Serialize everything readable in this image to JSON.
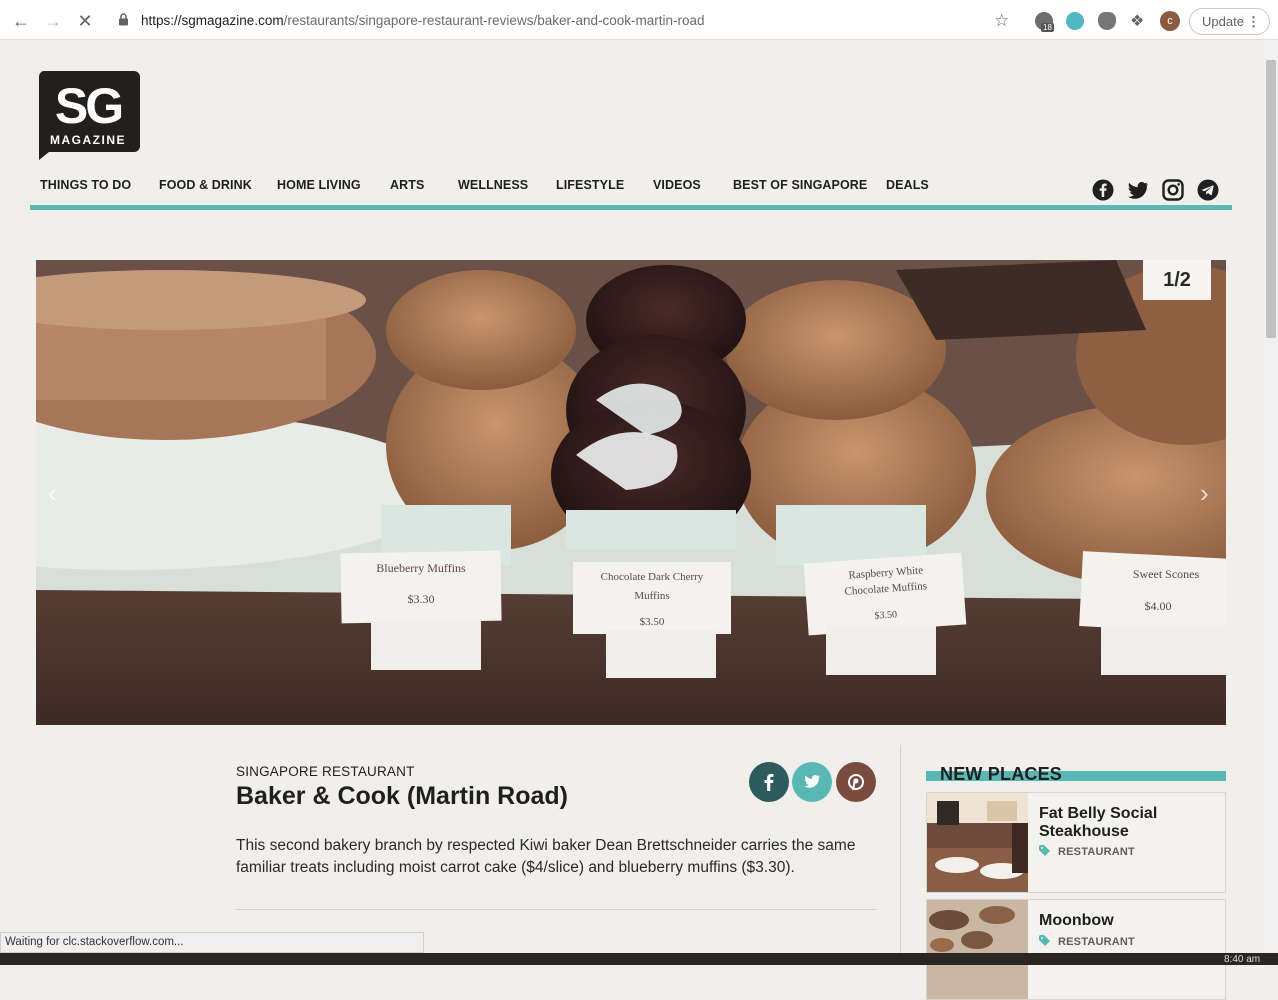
{
  "browser": {
    "url_host": "https://sgmagazine.com",
    "url_path": "/restaurants/singapore-restaurant-reviews/baker-and-cook-martin-road",
    "update_label": "Update",
    "profile_initial": "c",
    "badge_count": "18",
    "status_text": "Waiting for clc.stackoverflow.com...",
    "clock": "8:40 am"
  },
  "logo": {
    "letters": "SG",
    "word": "MAGAZINE"
  },
  "nav": {
    "items": [
      "THINGS TO DO",
      "FOOD & DRINK",
      "HOME LIVING",
      "ARTS",
      "WELLNESS",
      "LIFESTYLE",
      "VIDEOS",
      "BEST OF SINGAPORE",
      "DEALS"
    ]
  },
  "social": [
    "facebook-icon",
    "twitter-icon",
    "instagram-icon",
    "telegram-icon"
  ],
  "slider": {
    "counter": "1/2",
    "labels": [
      {
        "name": "Blueberry Muffins",
        "price": "$3.30"
      },
      {
        "name": "Chocolate Dark Cherry Muffins",
        "price": "$3.50"
      },
      {
        "name": "Raspberry White Chocolate Muffins",
        "price": "$3.50"
      },
      {
        "name": "Sweet Scones",
        "price": "$4.00"
      }
    ]
  },
  "article": {
    "category": "SINGAPORE RESTAURANT",
    "title": "Baker & Cook (Martin Road)",
    "description": "This second bakery branch by respected Kiwi baker Dean Brettschneider carries the same familiar treats including moist carrot cake ($4/slice) and blueberry muffins ($3.30).",
    "share": {
      "facebook": "f",
      "twitter": "t",
      "pinterest": "p"
    }
  },
  "sidebar": {
    "heading": "NEW PLACES",
    "cards": [
      {
        "name": "Fat Belly Social Steakhouse",
        "tag": "RESTAURANT"
      },
      {
        "name": "Moonbow",
        "tag": "RESTAURANT"
      }
    ]
  },
  "colors": {
    "accent": "#5ab8b4",
    "facebook_share": "#2f5a5e",
    "twitter_share": "#5ab8b4",
    "pinterest_share": "#7a4c3e"
  }
}
